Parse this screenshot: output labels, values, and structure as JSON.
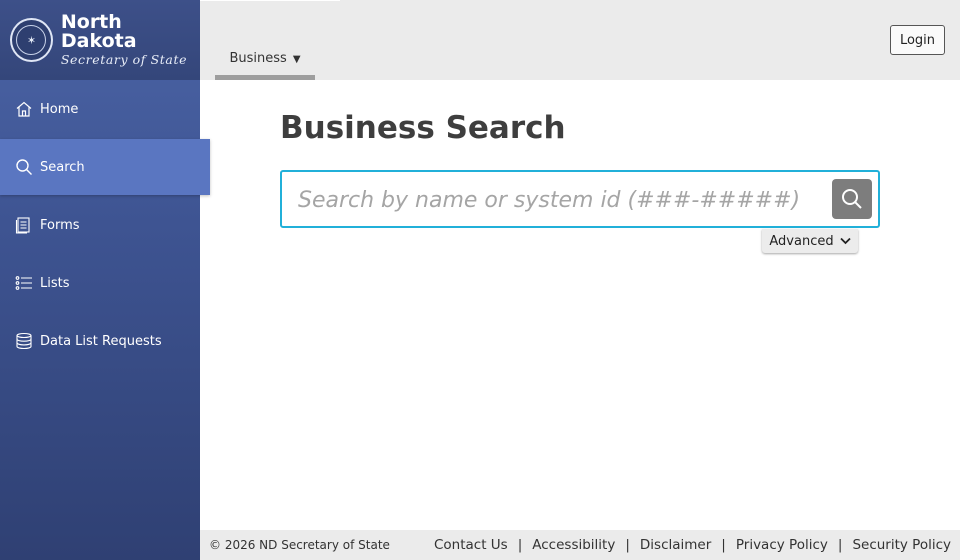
{
  "brand": {
    "title": "North Dakota",
    "subtitle": "Secretary of State"
  },
  "nav": {
    "items": [
      {
        "label": "Home",
        "icon": "home-icon"
      },
      {
        "label": "Search",
        "icon": "search-icon",
        "active": true
      },
      {
        "label": "Forms",
        "icon": "document-icon"
      },
      {
        "label": "Lists",
        "icon": "list-icon"
      },
      {
        "label": "Data List Requests",
        "icon": "database-icon"
      }
    ]
  },
  "topbar": {
    "tab_label": "Business",
    "login_label": "Login"
  },
  "main": {
    "title": "Business Search",
    "search_placeholder": "Search by name or system id (###-#####)",
    "advanced_label": "Advanced"
  },
  "footer": {
    "copyright": "© 2026 ND Secretary of State",
    "links": [
      "Contact Us",
      "Accessibility",
      "Disclaimer",
      "Privacy Policy",
      "Security Policy"
    ],
    "separator": "|"
  },
  "colors": {
    "sidebar": "#3e5492",
    "sidebar_active": "#5a76c1",
    "search_border": "#21b0d9",
    "search_button": "#7d7d7d",
    "topbar": "#ebebeb"
  }
}
